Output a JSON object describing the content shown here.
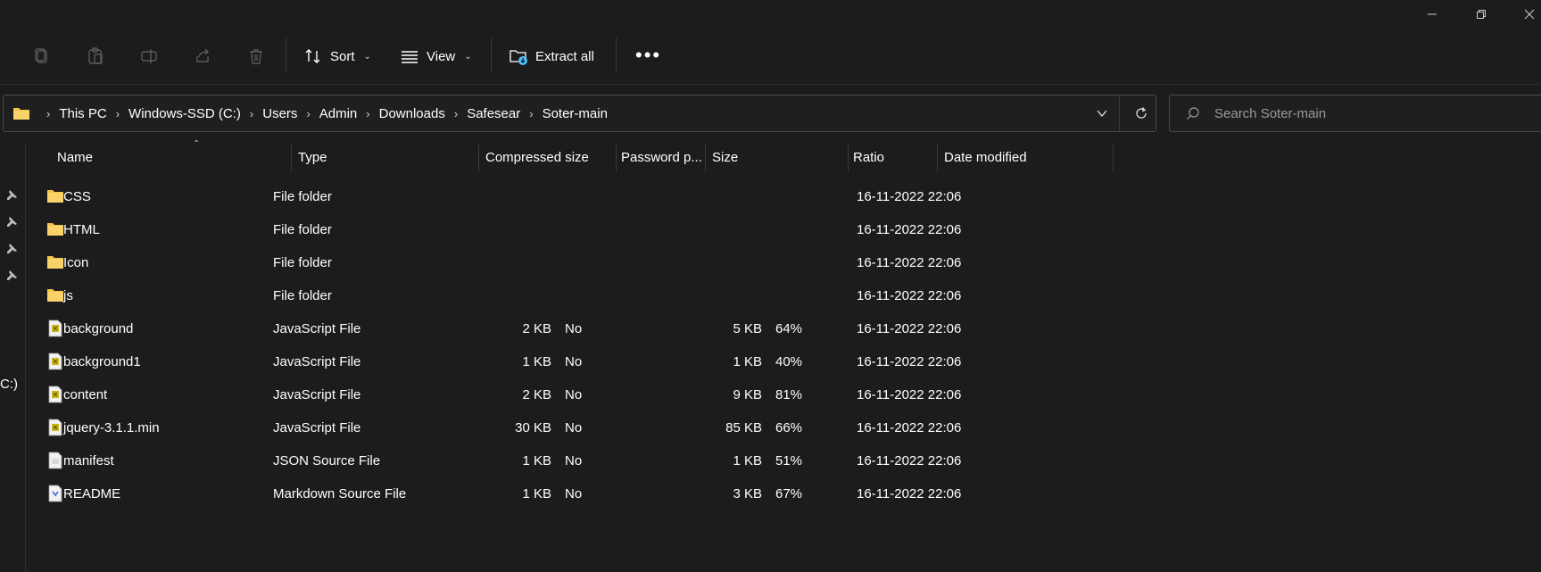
{
  "window": {
    "minimize_icon": "minimize-icon",
    "restore_icon": "restore-icon",
    "close_icon": "close-icon"
  },
  "toolbar": {
    "sort_label": "Sort",
    "view_label": "View",
    "extract_label": "Extract all",
    "more_label": "•••"
  },
  "address": {
    "crumbs": [
      "This PC",
      "Windows-SSD (C:)",
      "Users",
      "Admin",
      "Downloads",
      "Safesear",
      "Soter-main"
    ]
  },
  "search": {
    "placeholder": "Search Soter-main"
  },
  "navpane": {
    "partial_text": "C:)"
  },
  "columns": {
    "name": "Name",
    "type": "Type",
    "compressed": "Compressed size",
    "password": "Password p...",
    "size": "Size",
    "ratio": "Ratio",
    "date": "Date modified"
  },
  "files": [
    {
      "name": "CSS",
      "icon": "folder-icon",
      "type": "File folder",
      "compressed": "",
      "password": "",
      "size": "",
      "ratio": "",
      "date": "16-11-2022 22:06"
    },
    {
      "name": "HTML",
      "icon": "folder-icon",
      "type": "File folder",
      "compressed": "",
      "password": "",
      "size": "",
      "ratio": "",
      "date": "16-11-2022 22:06"
    },
    {
      "name": "Icon",
      "icon": "folder-icon",
      "type": "File folder",
      "compressed": "",
      "password": "",
      "size": "",
      "ratio": "",
      "date": "16-11-2022 22:06"
    },
    {
      "name": "js",
      "icon": "folder-icon",
      "type": "File folder",
      "compressed": "",
      "password": "",
      "size": "",
      "ratio": "",
      "date": "16-11-2022 22:06"
    },
    {
      "name": "background",
      "icon": "js-file-icon",
      "type": "JavaScript File",
      "compressed": "2 KB",
      "password": "No",
      "size": "5 KB",
      "ratio": "64%",
      "date": "16-11-2022 22:06"
    },
    {
      "name": "background1",
      "icon": "js-file-icon",
      "type": "JavaScript File",
      "compressed": "1 KB",
      "password": "No",
      "size": "1 KB",
      "ratio": "40%",
      "date": "16-11-2022 22:06"
    },
    {
      "name": "content",
      "icon": "js-file-icon",
      "type": "JavaScript File",
      "compressed": "2 KB",
      "password": "No",
      "size": "9 KB",
      "ratio": "81%",
      "date": "16-11-2022 22:06"
    },
    {
      "name": "jquery-3.1.1.min",
      "icon": "js-file-icon",
      "type": "JavaScript File",
      "compressed": "30 KB",
      "password": "No",
      "size": "85 KB",
      "ratio": "66%",
      "date": "16-11-2022 22:06"
    },
    {
      "name": "manifest",
      "icon": "json-file-icon",
      "type": "JSON Source File",
      "compressed": "1 KB",
      "password": "No",
      "size": "1 KB",
      "ratio": "51%",
      "date": "16-11-2022 22:06"
    },
    {
      "name": "README",
      "icon": "markdown-file-icon",
      "type": "Markdown Source File",
      "compressed": "1 KB",
      "password": "No",
      "size": "3 KB",
      "ratio": "67%",
      "date": "16-11-2022 22:06"
    }
  ],
  "colors": {
    "background": "#1c1c1c",
    "folder": "#f6c34a",
    "accent": "#4cc2ff"
  }
}
